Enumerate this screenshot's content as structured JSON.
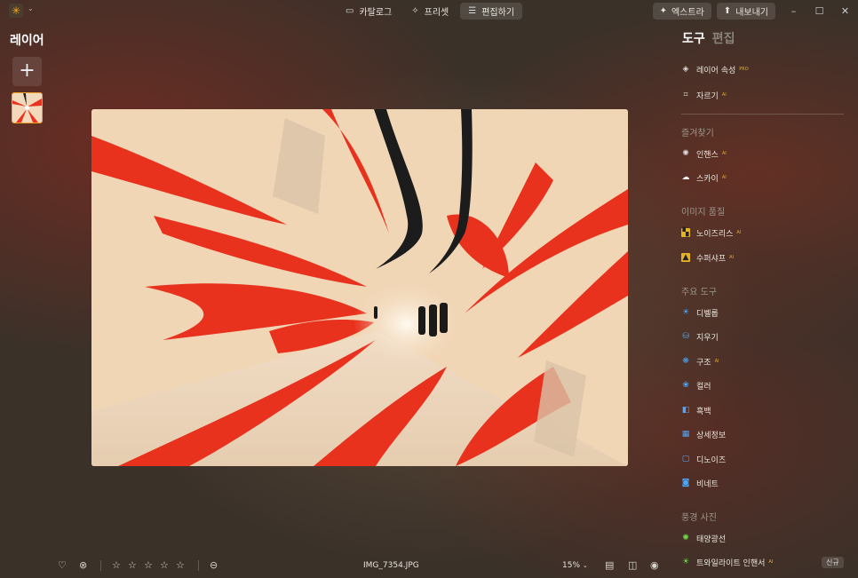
{
  "topbar": {
    "modes": [
      {
        "label": "카탈로그",
        "icon": "folder-icon"
      },
      {
        "label": "프리셋",
        "icon": "sparkle-icon"
      },
      {
        "label": "편집하기",
        "icon": "sliders-icon",
        "active": true
      }
    ],
    "extra_label": "엑스트라",
    "export_label": "내보내기"
  },
  "layers": {
    "title": "레이어"
  },
  "panel": {
    "tab_tools": "도구",
    "tab_edit": "편집",
    "top_tools": [
      {
        "label": "레이어 속성",
        "badge": "PRO",
        "icon": "layers-icon"
      },
      {
        "label": "자르기",
        "badge": "AI",
        "icon": "crop-icon"
      }
    ],
    "sections": [
      {
        "title": "즐겨찾기",
        "items": [
          {
            "label": "인핸스",
            "badge": "AI",
            "icon": "enhance-icon"
          },
          {
            "label": "스카이",
            "badge": "AI",
            "icon": "cloud-icon"
          }
        ]
      },
      {
        "title": "이미지 품질",
        "items": [
          {
            "label": "노이즈리스",
            "badge": "AI",
            "icon": "noiseless-icon"
          },
          {
            "label": "수퍼샤프",
            "badge": "AI",
            "icon": "supersharp-icon"
          }
        ]
      },
      {
        "title": "주요 도구",
        "items": [
          {
            "label": "디벨롭",
            "badge": "",
            "icon": "sun-icon"
          },
          {
            "label": "지우기",
            "badge": "",
            "icon": "eraser-icon"
          },
          {
            "label": "구조",
            "badge": "AI",
            "icon": "structure-icon"
          },
          {
            "label": "컬러",
            "badge": "",
            "icon": "color-icon"
          },
          {
            "label": "흑백",
            "badge": "",
            "icon": "bw-icon"
          },
          {
            "label": "상세정보",
            "badge": "",
            "icon": "details-icon"
          },
          {
            "label": "디노이즈",
            "badge": "",
            "icon": "denoise-icon"
          },
          {
            "label": "비네트",
            "badge": "",
            "icon": "vignette-icon"
          }
        ]
      },
      {
        "title": "풍경 사진",
        "items": [
          {
            "label": "태양광선",
            "badge": "",
            "icon": "sunrays-icon"
          },
          {
            "label": "트와일라이트 인핸서",
            "badge": "AI",
            "icon": "twilight-icon"
          }
        ]
      }
    ],
    "new_badge": "신규"
  },
  "bottombar": {
    "filename": "IMG_7354.JPG",
    "zoom": "15%",
    "rating": 0
  },
  "colors": {
    "accent": "#f5a623",
    "background": "#3a3129",
    "photo_red": "#e8321e",
    "photo_cream": "#f2d9bc"
  }
}
